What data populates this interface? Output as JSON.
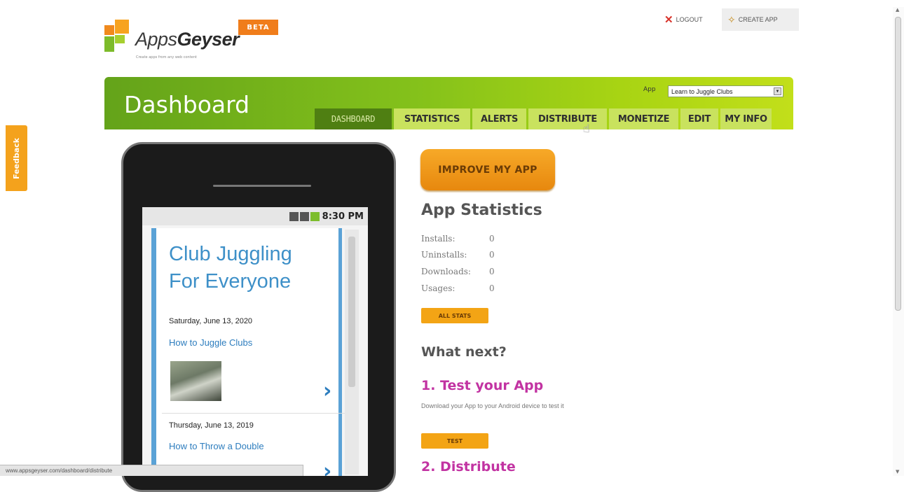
{
  "feedback": {
    "label": "Feedback"
  },
  "logo": {
    "brand_light": "Apps",
    "brand_bold": "Geyser",
    "tagline": "Create apps from any web content",
    "beta": "BETA"
  },
  "top_links": {
    "logout": "LOGOUT",
    "create_app": "CREATE APP"
  },
  "header": {
    "title": "Dashboard",
    "app_label": "App",
    "app_selected": "Learn to Juggle Clubs",
    "tabs": [
      "DASHBOARD",
      "STATISTICS",
      "ALERTS",
      "DISTRIBUTE",
      "MONETIZE",
      "EDIT",
      "MY INFO"
    ],
    "active_tab": "DASHBOARD"
  },
  "phone": {
    "time": "8:30 PM",
    "blog_title_line1": "Club Juggling",
    "blog_title_line2": "For Everyone",
    "posts": [
      {
        "date": "Saturday, June 13, 2020",
        "title": "How to Juggle Clubs"
      },
      {
        "date": "Thursday, June 13, 2019",
        "title": "How to Throw a Double"
      }
    ]
  },
  "improve_button": "IMPROVE MY APP",
  "stats": {
    "heading": "App Statistics",
    "rows": [
      {
        "label": "Installs:",
        "value": "0"
      },
      {
        "label": "Uninstalls:",
        "value": "0"
      },
      {
        "label": "Downloads:",
        "value": "0"
      },
      {
        "label": "Usages:",
        "value": "0"
      }
    ],
    "all_stats_button": "ALL STATS"
  },
  "next": {
    "heading": "What next?",
    "step1": "1. Test your App",
    "step1_desc": "Download your App to your Android device to test it",
    "test_button": "TEST",
    "step2": "2. Distribute"
  },
  "status_url": "www.appsgeyser.com/dashboard/distribute",
  "colors": {
    "header_green": "#84c11b",
    "active_tab": "#4f7f12",
    "accent_orange": "#f3a415",
    "step_magenta": "#c233a2",
    "link_blue": "#2d7dbe"
  }
}
